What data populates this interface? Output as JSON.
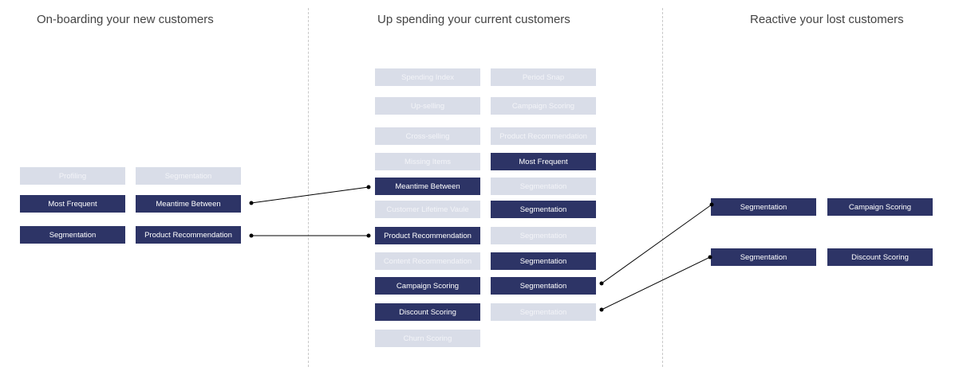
{
  "columns": [
    {
      "title": "On-boarding your new customers"
    },
    {
      "title": "Up spending your current customers"
    },
    {
      "title": "Reactive your lost customers"
    }
  ],
  "left": [
    {
      "label": "Profiling",
      "style": "light"
    },
    {
      "label": "Segmentation",
      "style": "light"
    },
    {
      "label": "Most Frequent",
      "style": "dark"
    },
    {
      "label": "Meantime Between",
      "style": "dark"
    },
    {
      "label": "Segmentation",
      "style": "dark"
    },
    {
      "label": "Product Recommendation",
      "style": "dark"
    }
  ],
  "middle": [
    {
      "label": "Spending Index",
      "style": "light"
    },
    {
      "label": "Period Snap",
      "style": "light"
    },
    {
      "label": "Up-selling",
      "style": "light"
    },
    {
      "label": "Campaign Scoring",
      "style": "light"
    },
    {
      "label": "Cross-selling",
      "style": "light"
    },
    {
      "label": "Product Recommendation",
      "style": "light"
    },
    {
      "label": "Missing Items",
      "style": "light"
    },
    {
      "label": "Most Frequent",
      "style": "dark"
    },
    {
      "label": "Meantime Between",
      "style": "dark"
    },
    {
      "label": "Segmentation",
      "style": "light"
    },
    {
      "label": "Customer Lifetime Vaule",
      "style": "light"
    },
    {
      "label": "Segmentation",
      "style": "dark"
    },
    {
      "label": "Product Recommendation",
      "style": "dark"
    },
    {
      "label": "Segmentation",
      "style": "light"
    },
    {
      "label": "Content Recommendation",
      "style": "light"
    },
    {
      "label": "Segmentation",
      "style": "dark"
    },
    {
      "label": "Campaign Scoring",
      "style": "dark"
    },
    {
      "label": "Segmentation",
      "style": "dark"
    },
    {
      "label": "Discount Scoring",
      "style": "dark"
    },
    {
      "label": "Segmentation",
      "style": "light"
    },
    {
      "label": "Churn Scoring",
      "style": "light"
    }
  ],
  "right": [
    {
      "label": "Segmentation",
      "style": "dark"
    },
    {
      "label": "Campaign Scoring",
      "style": "dark"
    },
    {
      "label": "Segmentation",
      "style": "dark"
    },
    {
      "label": "Discount Scoring",
      "style": "dark"
    }
  ],
  "colors": {
    "dark": "#2d3466",
    "light": "#d9dde8",
    "line": "#000000"
  }
}
